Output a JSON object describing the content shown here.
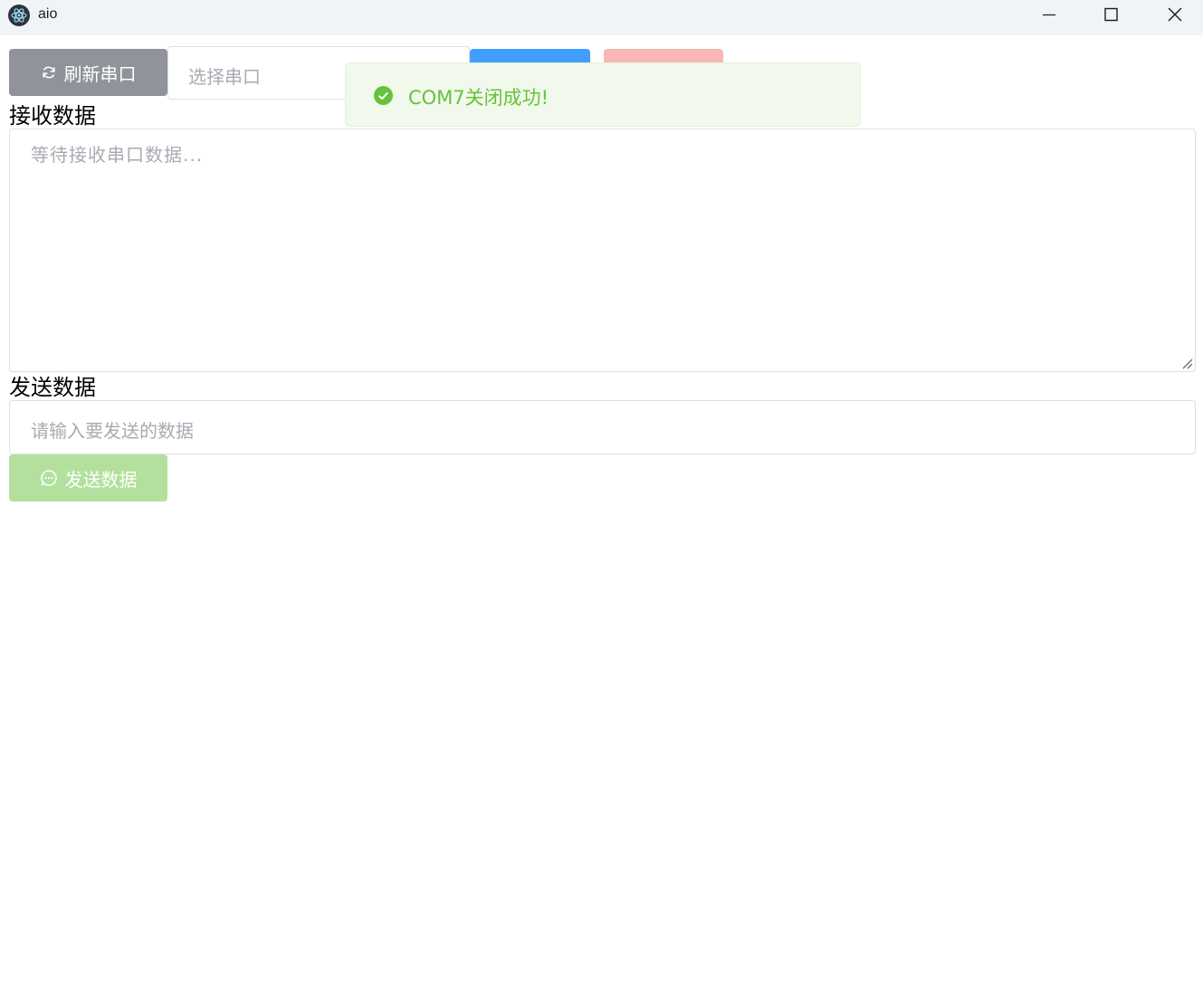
{
  "window": {
    "title": "aio",
    "controls": [
      "minimize-icon",
      "maximize-icon",
      "close-icon"
    ]
  },
  "toolbar": {
    "refresh_label": "刷新串口",
    "port_select_placeholder": "选择串口",
    "open_button_label": "",
    "close_button_label": ""
  },
  "notification": {
    "type": "success",
    "message": "COM7关闭成功!"
  },
  "receive": {
    "label": "接收数据",
    "placeholder": "等待接收串口数据..."
  },
  "send": {
    "label": "发送数据",
    "placeholder": "请输入要发送的数据",
    "button_label": "发送数据"
  },
  "colors": {
    "refresh_button": "#909399",
    "open_button": "#409eff",
    "close_button": "#fab6b6",
    "send_button": "#b3e19d",
    "success_text": "#67c23a",
    "success_bg": "#f0f9eb"
  }
}
